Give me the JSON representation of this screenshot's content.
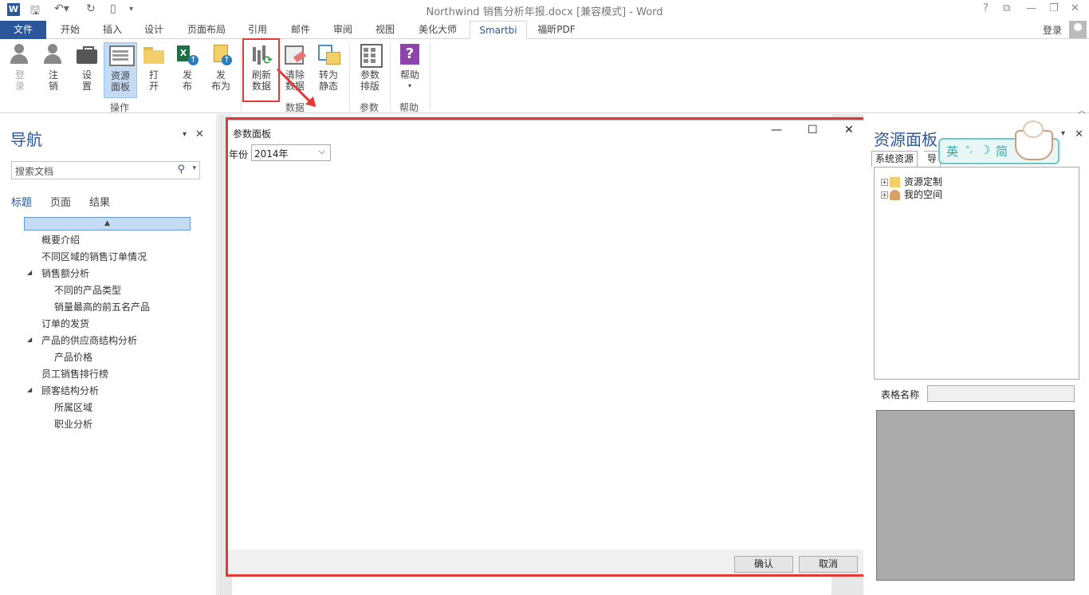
{
  "titlebar": {
    "title": "Northwind 销售分析年报.docx [兼容模式] - Word",
    "help": "?",
    "restore": "⧉",
    "minimize": "—",
    "maximize": "❐",
    "close": "✕"
  },
  "tabs": [
    "文件",
    "开始",
    "插入",
    "设计",
    "页面布局",
    "引用",
    "邮件",
    "审阅",
    "视图",
    "美化大师",
    "Smartbi",
    "福昕PDF"
  ],
  "active_tab": "Smartbi",
  "account": {
    "login_label": "登录"
  },
  "ribbon": {
    "groups": {
      "operate": "操作",
      "data": "数据",
      "params": "参数",
      "help": "帮助"
    },
    "buttons": {
      "login": [
        "登",
        "录"
      ],
      "logout": [
        "注",
        "销"
      ],
      "settings": [
        "设",
        "置"
      ],
      "resource_panel": [
        "资源",
        "面板"
      ],
      "open": [
        "打",
        "开"
      ],
      "publish": [
        "发",
        "布"
      ],
      "publish_as": [
        "发",
        "布为"
      ],
      "refresh_data": [
        "刷新",
        "数据"
      ],
      "clear_data": [
        "清除",
        "数据"
      ],
      "to_static": [
        "转为",
        "静态"
      ],
      "param_layout": [
        "参数",
        "排版"
      ],
      "help": [
        "帮助",
        "▾"
      ]
    }
  },
  "navigation": {
    "title": "导航",
    "search_placeholder": "搜索文档",
    "tabs": [
      "标题",
      "页面",
      "结果"
    ],
    "top_marker": "▲",
    "headings": [
      {
        "text": "概要介绍",
        "level": 1,
        "expandable": false
      },
      {
        "text": "不同区域的销售订单情况",
        "level": 1,
        "expandable": false
      },
      {
        "text": "销售额分析",
        "level": 1,
        "expandable": true
      },
      {
        "text": "不同的产品类型",
        "level": 2,
        "expandable": false
      },
      {
        "text": "销量最高的前五名产品",
        "level": 2,
        "expandable": false
      },
      {
        "text": "订单的发货",
        "level": 1,
        "expandable": false
      },
      {
        "text": "产品的供应商结构分析",
        "level": 1,
        "expandable": true
      },
      {
        "text": "产品价格",
        "level": 2,
        "expandable": false
      },
      {
        "text": "员工销售排行榜",
        "level": 1,
        "expandable": false
      },
      {
        "text": "顾客结构分析",
        "level": 1,
        "expandable": true
      },
      {
        "text": "所属区域",
        "level": 2,
        "expandable": false
      },
      {
        "text": "职业分析",
        "level": 2,
        "expandable": false
      }
    ]
  },
  "param_dialog": {
    "title": "参数面板",
    "year_label": "年份",
    "year_value": "2014年",
    "ok_label": "确认",
    "cancel_label": "取消",
    "minimize": "—",
    "maximize": "☐",
    "close": "✕"
  },
  "resource_panel": {
    "title": "资源面板",
    "tabs": [
      "系统资源",
      "导"
    ],
    "tree": [
      {
        "label": "资源定制",
        "icon": "folder-icon"
      },
      {
        "label": "我的空间",
        "icon": "user-icon"
      }
    ],
    "table_name_label": "表格名称",
    "table_name_value": ""
  },
  "ime": {
    "lang": "英",
    "punct": "°,",
    "moon": "☽",
    "mode": "简"
  },
  "colors": {
    "accent": "#2b579a",
    "highlight": "#e53935",
    "ribbon_selected": "#c5dbf3"
  }
}
